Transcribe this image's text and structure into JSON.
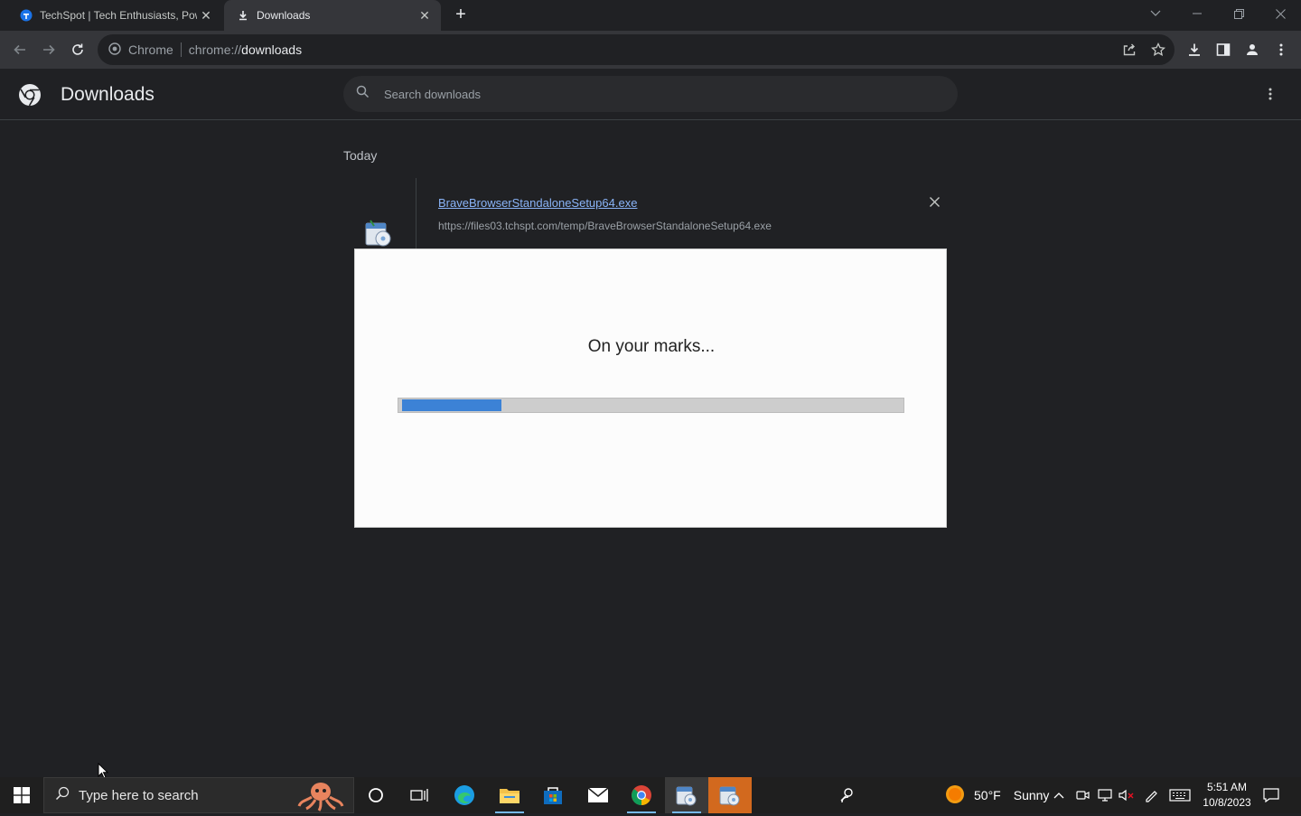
{
  "browser": {
    "tabs": [
      {
        "title": "TechSpot | Tech Enthusiasts, Pow",
        "active": false
      },
      {
        "title": "Downloads",
        "active": true
      }
    ],
    "omnibox": {
      "chip": "Chrome",
      "url_scheme": "chrome://",
      "url_host": "downloads"
    }
  },
  "page": {
    "title": "Downloads",
    "search_placeholder": "Search downloads",
    "section": "Today",
    "download": {
      "filename": "BraveBrowserStandaloneSetup64.exe",
      "url": "https://files03.tchspt.com/temp/BraveBrowserStandaloneSetup64.exe"
    }
  },
  "installer_dialog": {
    "message": "On your marks...",
    "progress": 0.2
  },
  "taskbar": {
    "search_placeholder": "Type here to search",
    "weather": {
      "temp": "50°F",
      "condition": "Sunny"
    },
    "time": "5:51 AM",
    "date": "10/8/2023"
  },
  "colors": {
    "accent_link": "#8ab4f8",
    "progress_fill": "#3c82d6",
    "taskbar_underline": "#76b9ed"
  }
}
